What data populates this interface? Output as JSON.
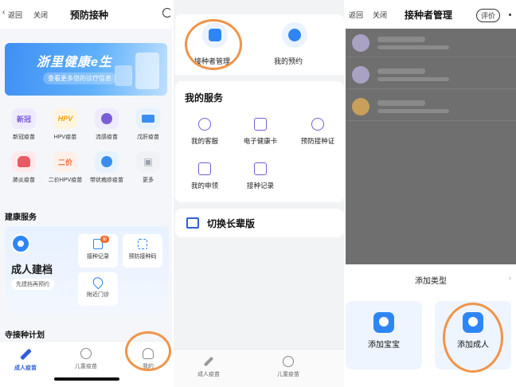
{
  "panel1": {
    "back_label": "返回",
    "close_label": "关闭",
    "title": "预防接种",
    "banner": {
      "title": "浙里健康e生",
      "subtitle": "查看更多您的诊疗信息"
    },
    "vaccines": [
      {
        "icon_text": "新冠",
        "label": "新冠疫苗",
        "bg": "#efeafd",
        "fg": "#7b5cd6"
      },
      {
        "icon_text": "HPV",
        "label": "HPV疫苗",
        "bg": "#fff5df",
        "fg": "#f2a400"
      },
      {
        "icon_text": "",
        "label": "流感疫苗",
        "bg": "#efeafd",
        "fg": "#7b5cd6"
      },
      {
        "icon_text": "",
        "label": "戊肝疫苗",
        "bg": "#e6f3ff",
        "fg": "#3a8ef0"
      },
      {
        "icon_text": "",
        "label": "肺炎疫苗",
        "bg": "#ffe9ea",
        "fg": "#e85a65"
      },
      {
        "icon_text": "二价",
        "label": "二价HPV疫苗",
        "bg": "#fff0e8",
        "fg": "#f26b3a"
      },
      {
        "icon_text": "",
        "label": "带状疱疹疫苗",
        "bg": "#e6f3ff",
        "fg": "#3a8ef0"
      },
      {
        "icon_text": "",
        "label": "更多",
        "bg": "#f1f2f5",
        "fg": "#9aa0ad"
      }
    ],
    "health_section_title": "建康服务",
    "health_card": {
      "title": "成人建档",
      "pill": "先建档再预约",
      "tiles": [
        {
          "label": "接种记录",
          "badge": "新"
        },
        {
          "label": "预防接种码",
          "badge": ""
        },
        {
          "label": "附近门诊",
          "badge": ""
        }
      ]
    },
    "pending_section_title": "寺接种计划",
    "tabs": [
      {
        "label": "成人疫苗",
        "active": true
      },
      {
        "label": "儿童疫苗",
        "active": false
      },
      {
        "label": "我的",
        "active": false
      }
    ]
  },
  "panel2": {
    "top_items": [
      {
        "label": "接种者管理"
      },
      {
        "label": "我的预约"
      }
    ],
    "services_title": "我的服务",
    "services": [
      {
        "label": "我的客服"
      },
      {
        "label": "电子健康卡"
      },
      {
        "label": "预防接种证"
      },
      {
        "label": "我的申领"
      },
      {
        "label": "接种记录"
      }
    ],
    "elder_mode_label": "切换长辈版",
    "tabs": [
      {
        "label": "成人疫苗"
      },
      {
        "label": "儿童疫苗"
      }
    ]
  },
  "panel3": {
    "back_label": "返回",
    "close_label": "关闭",
    "title": "接种者管理",
    "rate_label": "评价",
    "sheet_title": "添加类型",
    "options": [
      {
        "label": "添加宝宝"
      },
      {
        "label": "添加成人"
      }
    ]
  },
  "colors": {
    "accent": "#2e86f6",
    "annotation": "#f0944a",
    "purple_icon": "#7b5cd6"
  }
}
